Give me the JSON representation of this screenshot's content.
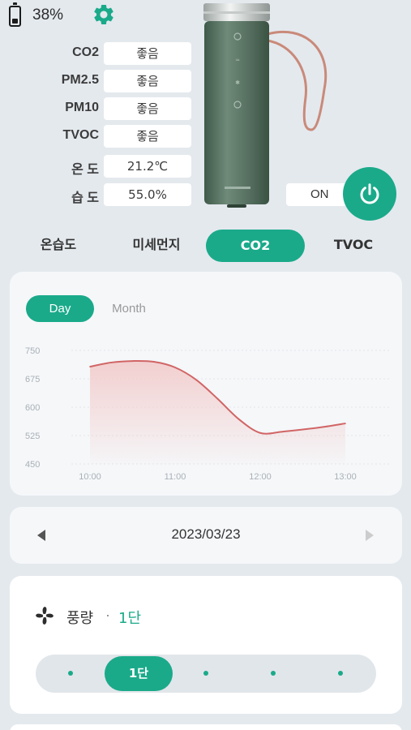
{
  "status": {
    "battery_percent": 38,
    "battery_text": "38%"
  },
  "readings": [
    {
      "label": "CO2",
      "value": "좋음"
    },
    {
      "label": "PM2.5",
      "value": "좋음"
    },
    {
      "label": "PM10",
      "value": "좋음"
    },
    {
      "label": "TVOC",
      "value": "좋음"
    },
    {
      "label": "온 도",
      "value": "21.2℃"
    },
    {
      "label": "습 도",
      "value": "55.0%"
    }
  ],
  "power": {
    "state_label": "ON"
  },
  "tabs": [
    {
      "label": "온습도",
      "active": false
    },
    {
      "label": "미세먼지",
      "active": false
    },
    {
      "label": "CO2",
      "active": true
    },
    {
      "label": "TVOC",
      "active": false
    }
  ],
  "range": {
    "day_label": "Day",
    "month_label": "Month",
    "selected": "Day"
  },
  "chart_data": {
    "type": "area",
    "x": [
      "10:00",
      "11:00",
      "12:00",
      "13:00"
    ],
    "y_ticks": [
      750,
      675,
      600,
      525,
      450
    ],
    "ylim": [
      450,
      750
    ],
    "series": [
      {
        "points": [
          {
            "t": 10.0,
            "y": 707
          },
          {
            "t": 10.25,
            "y": 718
          },
          {
            "t": 10.5,
            "y": 722
          },
          {
            "t": 10.75,
            "y": 720
          },
          {
            "t": 11.0,
            "y": 705
          },
          {
            "t": 11.25,
            "y": 672
          },
          {
            "t": 11.5,
            "y": 622
          },
          {
            "t": 11.75,
            "y": 568
          },
          {
            "t": 12.0,
            "y": 532
          },
          {
            "t": 12.25,
            "y": 535
          },
          {
            "t": 12.5,
            "y": 541
          },
          {
            "t": 12.75,
            "y": 548
          },
          {
            "t": 13.0,
            "y": 557
          }
        ]
      }
    ],
    "colors": {
      "line": "#d16565",
      "fill": "#f2c8c8",
      "grid": "#e2e6ea"
    }
  },
  "date_nav": {
    "date": "2023/03/23"
  },
  "fan": {
    "title": "풍량",
    "separator": "·",
    "level": "1단",
    "knob_label": "1단",
    "step_count": 5,
    "selected_step": 2
  },
  "colors": {
    "accent": "#1aaa8a",
    "background": "#e4e9ee"
  }
}
